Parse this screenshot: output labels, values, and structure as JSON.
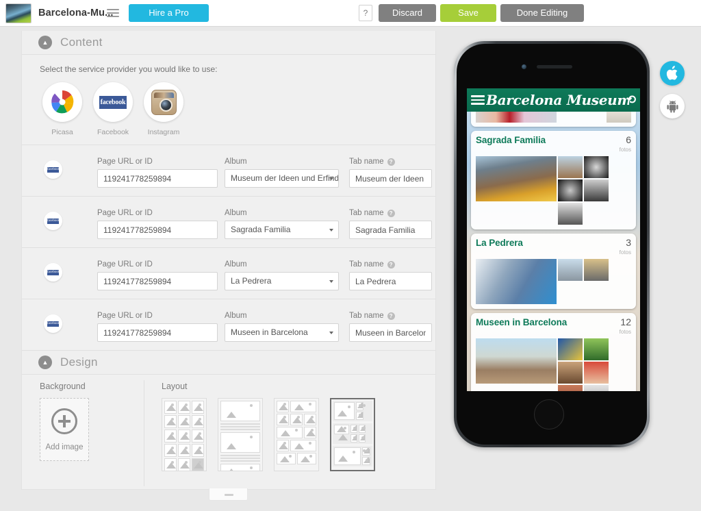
{
  "topbar": {
    "site_title": "Barcelona-Mu...",
    "menu_icon": "hamburger-icon",
    "hire_pro_label": "Hire a Pro",
    "help_label": "?",
    "discard_label": "Discard",
    "save_label": "Save",
    "done_label": "Done Editing",
    "colors": {
      "hire_pro": "#22b8e0",
      "save": "#a6ce39",
      "neutral": "#808080"
    }
  },
  "content_section": {
    "title": "Content",
    "collapse_icon": "chevron-up-icon",
    "prompt": "Select the service provider you would like to use:",
    "providers": [
      {
        "name": "Picasa",
        "icon": "picasa-icon"
      },
      {
        "name": "Facebook",
        "icon": "facebook-icon"
      },
      {
        "name": "Instagram",
        "icon": "instagram-icon"
      }
    ],
    "field_labels": {
      "url": "Page URL or ID",
      "album": "Album",
      "tab": "Tab name",
      "help_icon": "question-mark-icon"
    },
    "rows": [
      {
        "provider_icon": "facebook-icon",
        "url": "119241778259894",
        "album": "Museum der Ideen und Erfind",
        "tab": "Museum der Ideen und"
      },
      {
        "provider_icon": "facebook-icon",
        "url": "119241778259894",
        "album": "Sagrada Familia",
        "tab": "Sagrada Familia"
      },
      {
        "provider_icon": "facebook-icon",
        "url": "119241778259894",
        "album": "La Pedrera",
        "tab": "La Pedrera"
      },
      {
        "provider_icon": "facebook-icon",
        "url": "119241778259894",
        "album": "Museen in Barcelona",
        "tab": "Museen in Barcelona"
      }
    ]
  },
  "design_section": {
    "title": "Design",
    "collapse_icon": "chevron-up-icon",
    "background_label": "Background",
    "add_image_label": "Add image",
    "add_icon": "plus-circle-icon",
    "layout_label": "Layout",
    "layouts": [
      {
        "name": "grid-3-column",
        "selected": false
      },
      {
        "name": "single-column-large",
        "selected": false
      },
      {
        "name": "mixed-rows",
        "selected": false
      },
      {
        "name": "masonry-blocks",
        "selected": true
      }
    ]
  },
  "panel_handle": {
    "icon": "collapse-handle-icon"
  },
  "preview": {
    "device": "iphone",
    "app": {
      "menu_icon": "hamburger-icon",
      "title": "Barcelona Museum",
      "refresh_icon": "refresh-icon",
      "header_color": "#0e7a59",
      "albums": [
        {
          "title": "Sagrada Familia",
          "count": "6",
          "count_label": "fotos"
        },
        {
          "title": "La Pedrera",
          "count": "3",
          "count_label": "fotos"
        },
        {
          "title": "Museen in Barcelona",
          "count": "12",
          "count_label": "fotos"
        }
      ]
    }
  },
  "platform_switch": [
    {
      "name": "apple",
      "icon": "apple-icon",
      "glyph": "",
      "active": true,
      "color": "#22b8e0"
    },
    {
      "name": "android",
      "icon": "android-icon",
      "glyph": "⚙",
      "active": false,
      "color": "#ffffff"
    }
  ]
}
